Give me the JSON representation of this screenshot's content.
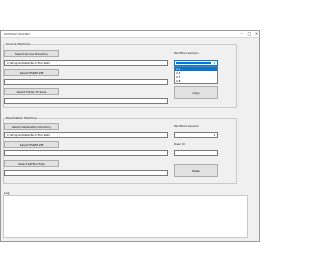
{
  "window": {
    "title": "DOTNAV VIOLIRD"
  },
  "source": {
    "group_label": "Source Machine",
    "select_dir_label": "Select Source Directory",
    "dir_value": "C:\\ProgramData\\Tech Tool Wall",
    "select_eswm_label": "Select ESWM ZIP",
    "eswm_value": "",
    "select_folder_label": "Select Folder To Save",
    "folder_value": "",
    "version_label": "TechTool version",
    "version_options": [
      "2.1",
      "2.5",
      "2.7",
      "2.8"
    ],
    "version_selected_index": 0,
    "copy_label": "Copy"
  },
  "destination": {
    "group_label": "Destination Machine",
    "select_dir_label": "Select Destination Directory",
    "dir_value": "C:\\ProgramData\\Tech Tool Wall",
    "select_eswm_label": "Select ESWM ZIP",
    "eswm_value": "",
    "select_settool_label": "Select SetTool Files",
    "settool_value": "",
    "version_label": "TechTool version",
    "version_value": "",
    "user_id_label": "User Id",
    "user_id_value": "",
    "paste_label": "Paste"
  },
  "log": {
    "group_label": "Log",
    "content": ""
  },
  "colors": {
    "accent": "#0078d7",
    "window_bg": "#f0f0f0"
  }
}
